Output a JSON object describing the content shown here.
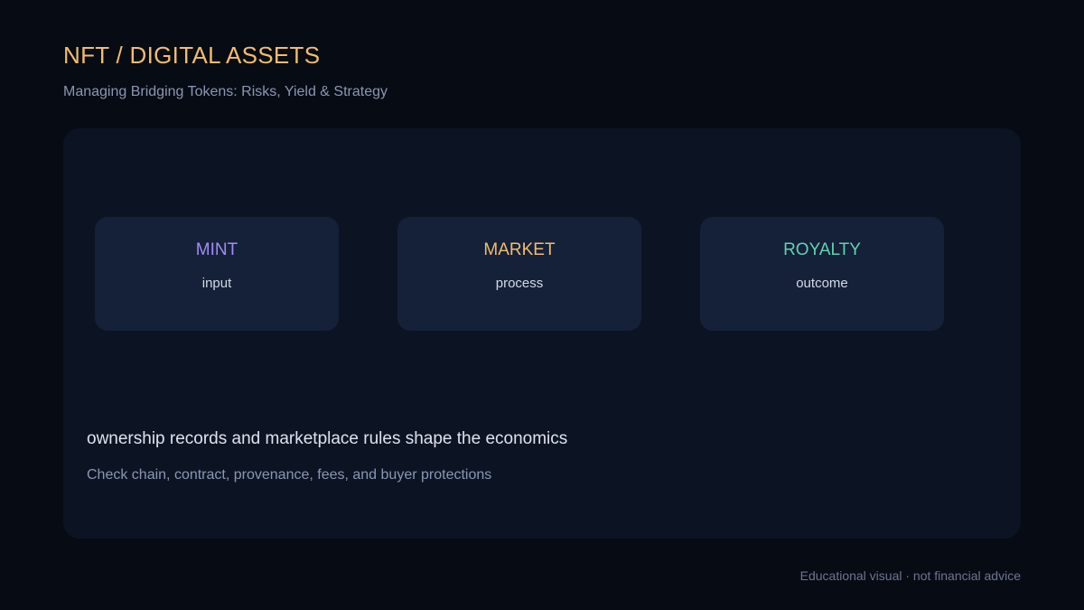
{
  "header": {
    "title": "NFT / DIGITAL ASSETS",
    "subtitle": "Managing Bridging Tokens: Risks, Yield & Strategy"
  },
  "flow": {
    "stages": [
      {
        "label": "MINT",
        "role": "input",
        "color": "#a28cf2"
      },
      {
        "label": "MARKET",
        "role": "process",
        "color": "#f2bc6c"
      },
      {
        "label": "ROYALTY",
        "role": "outcome",
        "color": "#5fd3b0"
      }
    ],
    "note": "ownership records and marketplace rules shape the economics",
    "detail": "Check chain, contract, provenance, fees, and buyer protections"
  },
  "footer": {
    "disclaimer": "Educational visual · not financial advice"
  }
}
